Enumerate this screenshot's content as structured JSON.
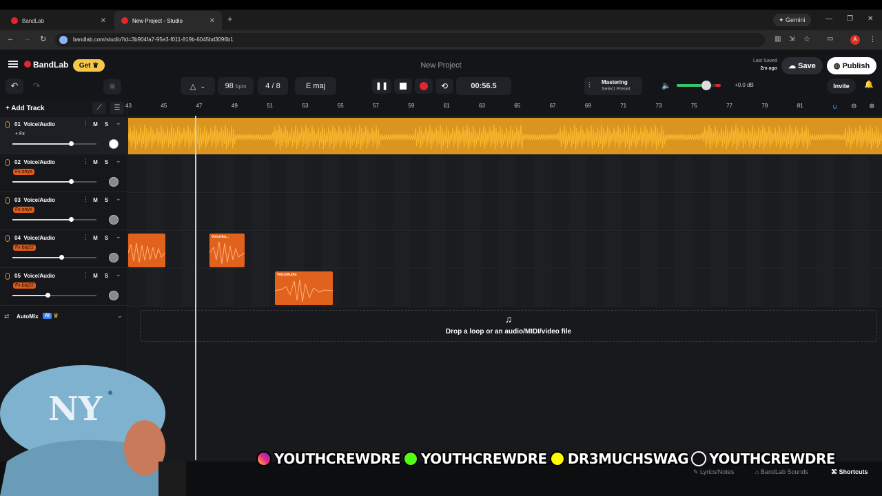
{
  "browser": {
    "tabs": [
      {
        "label": "BandLab"
      },
      {
        "label": "New Project - Studio"
      }
    ],
    "url": "bandlab.com/studio?id=3b904fa7-95e3-f011-819b-6045bd3096b1",
    "gemini_label": "Gemini",
    "profile_initial": "A"
  },
  "header": {
    "brand": "BandLab",
    "get_label": "Get",
    "project_title": "New Project",
    "last_saved_label": "Last Saved",
    "last_saved_time": "2m ago",
    "save_label": "Save",
    "publish_label": "Publish",
    "invite_label": "Invite"
  },
  "transport": {
    "bpm": "98",
    "bpm_unit": "bpm",
    "time_sig": "4 / 8",
    "key": "E maj",
    "time": "00:56.5",
    "mastering_label": "Mastering",
    "mastering_preset": "Select Preset",
    "volume_db": "+0.0 dB"
  },
  "sidebar": {
    "add_track_label": "Add Track",
    "automix_label": "AutoMix",
    "ai_badge": "AI"
  },
  "tracks": [
    {
      "num": "01",
      "name": "Voice/Audio",
      "fx": "+ Fx"
    },
    {
      "num": "02",
      "name": "Voice/Audio",
      "fx": "Fx onyx"
    },
    {
      "num": "03",
      "name": "Voice/Audio",
      "fx": "Fx onyx"
    },
    {
      "num": "04",
      "name": "Voice/Audio",
      "fx": "Fx bbj22"
    },
    {
      "num": "05",
      "name": "Voice/Audio",
      "fx": "Fx bbj22"
    }
  ],
  "ms": {
    "m": "M",
    "s": "S"
  },
  "ruler": [
    "43",
    "45",
    "47",
    "49",
    "51",
    "53",
    "55",
    "57",
    "59",
    "61",
    "63",
    "65",
    "67",
    "69",
    "71",
    "73",
    "75",
    "77",
    "79",
    "81"
  ],
  "clips": {
    "label": "Voice/Au...",
    "label2": "Voice/Audio"
  },
  "dropzone": {
    "text": "Drop a loop or an audio/MIDI/video file"
  },
  "bottom": {
    "lyrics_label": "Lyrics/Notes",
    "sounds_label": "BandLab Sounds",
    "shortcuts_label": "Shortcuts"
  },
  "overlay": {
    "handle1": "YOUTHCREWDRE",
    "handle2": "YOUTHCREWDRE",
    "handle3": "DR3MUCHSWAG",
    "handle4": "YOUTHCREWDRE"
  },
  "colors": {
    "accent": "#e0262e",
    "lane1": "#d9951f",
    "clip": "#e0621c",
    "get_badge": "#f5c84b"
  }
}
